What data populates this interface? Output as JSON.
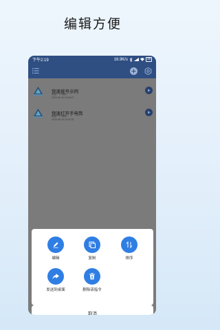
{
  "headline": "编辑方便",
  "status": {
    "time": "下午2:19",
    "speed": "16.9K/s",
    "battery": "39"
  },
  "list": [
    {
      "title": "快速拨号示例",
      "sub": "类型：TT规则",
      "date": "2020-06-16 10:44:47"
    },
    {
      "title": "快速打开手电筒",
      "sub": "类型：TT规则",
      "date": "2020-06-16 10:41:31"
    }
  ],
  "actions": [
    {
      "label": "编辑",
      "icon": "pencil-icon"
    },
    {
      "label": "复制",
      "icon": "copy-icon"
    },
    {
      "label": "排序",
      "icon": "sort-icon"
    },
    {
      "label": "发送到桌面",
      "icon": "share-arrow-icon"
    },
    {
      "label": "删除该指令",
      "icon": "trash-icon"
    }
  ],
  "cancel_label": "取消",
  "nav": {
    "back": "‹",
    "home": "○",
    "menu": "≡"
  },
  "colors": {
    "appbar": "#2f4f83",
    "accent": "#2f7ee4",
    "play": "#27406c"
  }
}
